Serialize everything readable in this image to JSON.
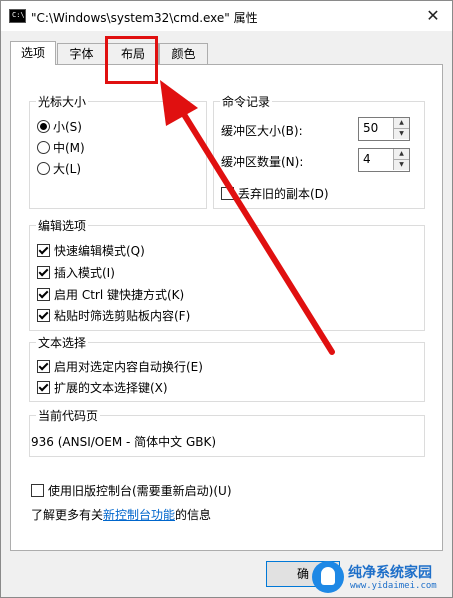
{
  "window": {
    "icon_text": "C:\\",
    "title": "\"C:\\Windows\\system32\\cmd.exe\" 属性",
    "close_glyph": "✕"
  },
  "tabs": [
    {
      "label": "选项",
      "active": true
    },
    {
      "label": "字体",
      "active": false
    },
    {
      "label": "布局",
      "active": false
    },
    {
      "label": "颜色",
      "active": false
    }
  ],
  "cursor_size": {
    "title": "光标大小",
    "options": [
      {
        "label": "小(S)",
        "selected": true
      },
      {
        "label": "中(M)",
        "selected": false
      },
      {
        "label": "大(L)",
        "selected": false
      }
    ]
  },
  "command_history": {
    "title": "命令记录",
    "buffer_size_label": "缓冲区大小(B):",
    "buffer_size_value": "50",
    "buffer_count_label": "缓冲区数量(N):",
    "buffer_count_value": "4",
    "discard_old_label": "丢弃旧的副本(D)",
    "discard_old_checked": false
  },
  "edit_options": {
    "title": "编辑选项",
    "items": [
      {
        "label": "快速编辑模式(Q)",
        "checked": true
      },
      {
        "label": "插入模式(I)",
        "checked": true
      },
      {
        "label": "启用 Ctrl 键快捷方式(K)",
        "checked": true
      },
      {
        "label": "粘贴时筛选剪贴板内容(F)",
        "checked": true
      }
    ]
  },
  "text_selection": {
    "title": "文本选择",
    "items": [
      {
        "label": "启用对选定内容自动换行(E)",
        "checked": true
      },
      {
        "label": "扩展的文本选择键(X)",
        "checked": true
      }
    ]
  },
  "codepage": {
    "title": "当前代码页",
    "value": "936   (ANSI/OEM - 简体中文 GBK)"
  },
  "legacy_console": {
    "label": "使用旧版控制台(需要重新启动)(U)",
    "checked": false
  },
  "learn_more": {
    "prefix": "了解更多有关",
    "link": "新控制台功能",
    "suffix": "的信息"
  },
  "buttons": {
    "ok_label": "确"
  },
  "watermark": {
    "title": "纯净系统家园",
    "url": "www.yidaimei.com"
  },
  "colors": {
    "annotation_red": "#e01010",
    "link_blue": "#0066cc",
    "watermark_blue": "#1e6fc9"
  }
}
